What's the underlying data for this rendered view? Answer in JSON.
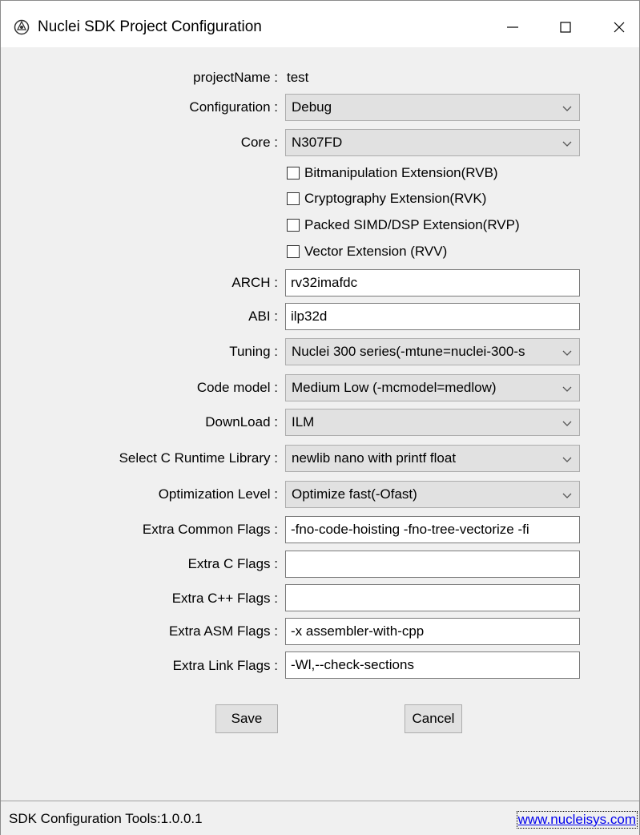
{
  "window": {
    "title": "Nuclei SDK Project Configuration"
  },
  "form": {
    "project_name_label": "projectName :",
    "project_name_value": "test",
    "configuration_label": "Configuration :",
    "configuration_value": "Debug",
    "core_label": "Core :",
    "core_value": "N307FD",
    "extensions": [
      {
        "label": "Bitmanipulation Extension(RVB)",
        "checked": false
      },
      {
        "label": "Cryptography Extension(RVK)",
        "checked": false
      },
      {
        "label": "Packed SIMD/DSP Extension(RVP)",
        "checked": false
      },
      {
        "label": "Vector Extension (RVV)",
        "checked": false
      }
    ],
    "arch_label": "ARCH :",
    "arch_value": "rv32imafdc",
    "abi_label": "ABI :",
    "abi_value": "ilp32d",
    "tuning_label": "Tuning :",
    "tuning_value": "Nuclei 300 series(-mtune=nuclei-300-s",
    "code_model_label": "Code model :",
    "code_model_value": "Medium Low (-mcmodel=medlow)",
    "download_label": "DownLoad :",
    "download_value": "ILM",
    "runtime_label": "Select C Runtime Library :",
    "runtime_value": "newlib nano with printf float",
    "optimization_label": "Optimization Level :",
    "optimization_value": "Optimize fast(-Ofast)",
    "common_flags_label": "Extra Common Flags :",
    "common_flags_value": "-fno-code-hoisting -fno-tree-vectorize -fi",
    "c_flags_label": "Extra C Flags :",
    "c_flags_value": "",
    "cpp_flags_label": "Extra C++ Flags :",
    "cpp_flags_value": "",
    "asm_flags_label": "Extra ASM Flags :",
    "asm_flags_value": "-x assembler-with-cpp",
    "link_flags_label": "Extra Link Flags :",
    "link_flags_value": "-Wl,--check-sections"
  },
  "buttons": {
    "save": "Save",
    "cancel": "Cancel"
  },
  "status": {
    "version": "SDK Configuration Tools:1.0.0.1",
    "link": "www.nucleisys.com"
  },
  "icons": {
    "app": "nuclei-logo-icon",
    "minimize": "minimize-icon",
    "maximize": "maximize-icon",
    "close": "close-icon",
    "dropdown": "chevron-down-icon"
  }
}
